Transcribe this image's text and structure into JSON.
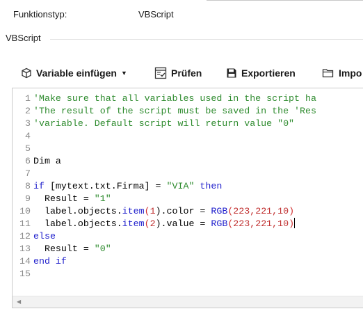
{
  "field": {
    "label": "Funktionstyp:",
    "value": "VBScript"
  },
  "group": {
    "title": "VBScript"
  },
  "toolbar": {
    "insert_variable": "Variable einfügen",
    "check": "Prüfen",
    "export": "Exportieren",
    "import": "Impo"
  },
  "editor": {
    "line_numbers": [
      "1",
      "2",
      "3",
      "4",
      "5",
      "6",
      "7",
      "8",
      "9",
      "10",
      "11",
      "12",
      "13",
      "14",
      "15"
    ],
    "lines": {
      "l1": "'Make sure that all variables used in the script ha",
      "l2": "'The result of the script must be saved in the 'Res",
      "l3": "'variable. Default script will return value \"0\"",
      "l6_kw": "Dim",
      "l6_rest": " a",
      "l8_kw": "if",
      "l8_mid": " [mytext.txt.Firma] = ",
      "l8_str": "\"VIA\"",
      "l8_kw2": " then",
      "l9_a": "  Result = ",
      "l9_str": "\"1\"",
      "l10_a": "  label.objects.",
      "l10_item": "item",
      "l10_b": "(",
      "l10_n1": "1",
      "l10_c": ").color = ",
      "l10_rgb": "RGB",
      "l10_d": "(",
      "l10_args": "223,221,10",
      "l10_e": ")",
      "l11_a": "  label.objects.",
      "l11_item": "item",
      "l11_b": "(",
      "l11_n1": "2",
      "l11_c": ").value = ",
      "l11_rgb": "RGB",
      "l11_d": "(",
      "l11_args": "223,221,10",
      "l11_e": ")",
      "l12_kw": "else",
      "l13_a": "  Result = ",
      "l13_str": "\"0\"",
      "l14_kw": "end if"
    }
  },
  "icons": [
    "cube-icon",
    "check-document-icon",
    "save-disk-icon",
    "folder-icon",
    "scroll-left-arrow-icon"
  ]
}
